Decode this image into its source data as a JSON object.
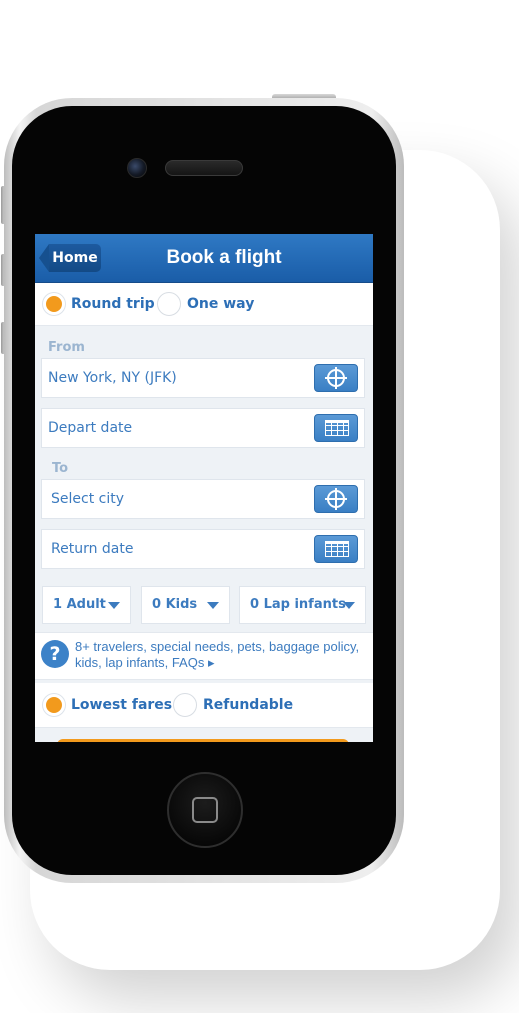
{
  "navbar": {
    "back_label": "Home",
    "title": "Book a flight"
  },
  "trip_type": {
    "options": [
      {
        "label": "Round trip",
        "selected": true
      },
      {
        "label": "One way",
        "selected": false
      }
    ]
  },
  "from": {
    "section_label": "From",
    "city_value": "New York, NY (JFK)",
    "date_placeholder": "Depart date"
  },
  "to": {
    "section_label": "To",
    "city_placeholder": "Select city",
    "date_placeholder": "Return date"
  },
  "travelers": {
    "adults": "1 Adult",
    "kids": "0 Kids",
    "lap_infants": "0 Lap infants"
  },
  "help": {
    "icon": "question-icon",
    "text": "8+ travelers, special needs, pets, baggage policy, kids, lap infants, FAQs ▸"
  },
  "fare_type": {
    "options": [
      {
        "label": "Lowest fares",
        "selected": true
      },
      {
        "label": "Refundable",
        "selected": false
      }
    ]
  },
  "colors": {
    "navbar": "#1f64ad",
    "accent": "#f29a1d",
    "text_blue": "#3c7bbf"
  }
}
